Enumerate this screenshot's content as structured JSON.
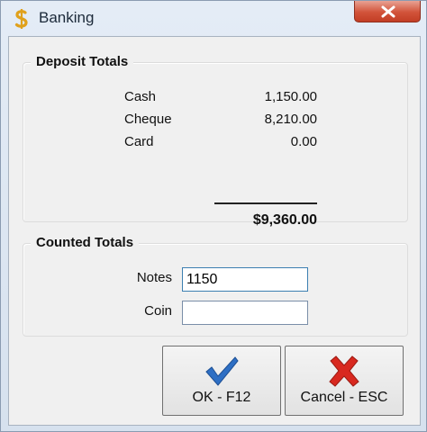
{
  "window": {
    "title": "Banking",
    "icon": "dollar-sign-icon"
  },
  "deposit_totals": {
    "heading": "Deposit Totals",
    "rows": [
      {
        "label": "Cash",
        "value": "1,150.00"
      },
      {
        "label": "Cheque",
        "value": "8,210.00"
      },
      {
        "label": "Card",
        "value": "0.00"
      }
    ],
    "total": "$9,360.00"
  },
  "counted_totals": {
    "heading": "Counted Totals",
    "notes_label": "Notes",
    "notes_value": "1150",
    "coin_label": "Coin",
    "coin_value": ""
  },
  "buttons": {
    "ok_label": "OK - F12",
    "cancel_label": "Cancel - ESC"
  },
  "colors": {
    "ok_check": "#2e6fc4",
    "cancel_cross": "#d8281f",
    "close_button": "#d2533a"
  }
}
